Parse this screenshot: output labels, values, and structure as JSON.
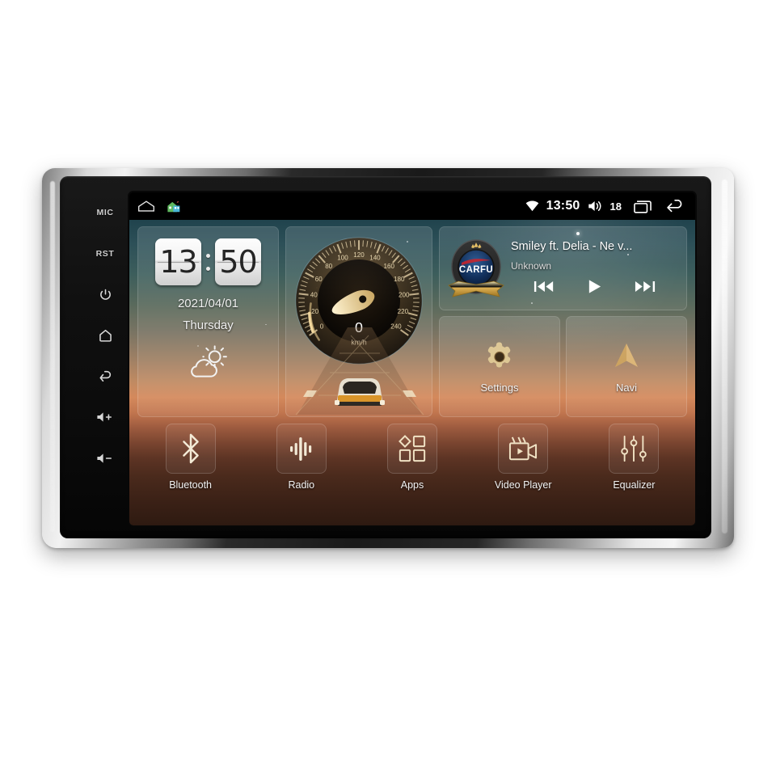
{
  "device": {
    "name": "android-car-head-unit",
    "hardkeys": [
      {
        "name": "mic",
        "label": "MIC",
        "type": "text"
      },
      {
        "name": "reset",
        "label": "RST",
        "type": "text"
      },
      {
        "name": "power",
        "label": "",
        "type": "icon"
      },
      {
        "name": "home",
        "label": "",
        "type": "icon"
      },
      {
        "name": "back",
        "label": "",
        "type": "icon"
      },
      {
        "name": "volume-up",
        "label": "",
        "type": "icon"
      },
      {
        "name": "volume-down",
        "label": "",
        "type": "icon"
      }
    ]
  },
  "statusbar": {
    "left_icons": [
      "home-outline-icon",
      "house-color-icon"
    ],
    "wifi_icon": "wifi-icon",
    "clock": "13:50",
    "volume_icon": "volume-icon",
    "volume_level": "18",
    "recents_icon": "recents-icon",
    "back_icon": "back-arrow-icon"
  },
  "clock_widget": {
    "hours": "13",
    "minutes": "50",
    "date": "2021/04/01",
    "weekday": "Thursday",
    "weather_icon": "sun-cloud-icon"
  },
  "speedometer": {
    "value": "0",
    "unit": "km/h",
    "ticks": [
      "0",
      "20",
      "40",
      "60",
      "80",
      "100",
      "120",
      "140",
      "160",
      "180",
      "200",
      "220",
      "240"
    ],
    "min": 0,
    "max": 240
  },
  "music": {
    "title": "Smiley ft. Delia - Ne v...",
    "artist": "Unknown",
    "album_art": "carfu-logo-badge",
    "logo_text": "CARFU",
    "prev_label": "previous-track",
    "play_label": "play",
    "next_label": "next-track"
  },
  "shortcuts": [
    {
      "name": "settings",
      "label": "Settings",
      "icon": "gear-icon"
    },
    {
      "name": "navi",
      "label": "Navi",
      "icon": "navigation-arrow-icon"
    }
  ],
  "dock": [
    {
      "name": "bluetooth",
      "label": "Bluetooth",
      "icon": "bluetooth-icon"
    },
    {
      "name": "radio",
      "label": "Radio",
      "icon": "radio-wave-icon"
    },
    {
      "name": "apps",
      "label": "Apps",
      "icon": "apps-grid-icon"
    },
    {
      "name": "video-player",
      "label": "Video Player",
      "icon": "video-camera-icon"
    },
    {
      "name": "equalizer",
      "label": "Equalizer",
      "icon": "equalizer-sliders-icon"
    }
  ],
  "colors": {
    "accent_gold": "#d8b878",
    "screen_black": "#000000",
    "bezel_silver": "#e8e8e8",
    "text_white": "#ffffff",
    "wall_top": "#20434d",
    "wall_mid": "#d4895c",
    "wall_bottom": "#2e1a11"
  }
}
